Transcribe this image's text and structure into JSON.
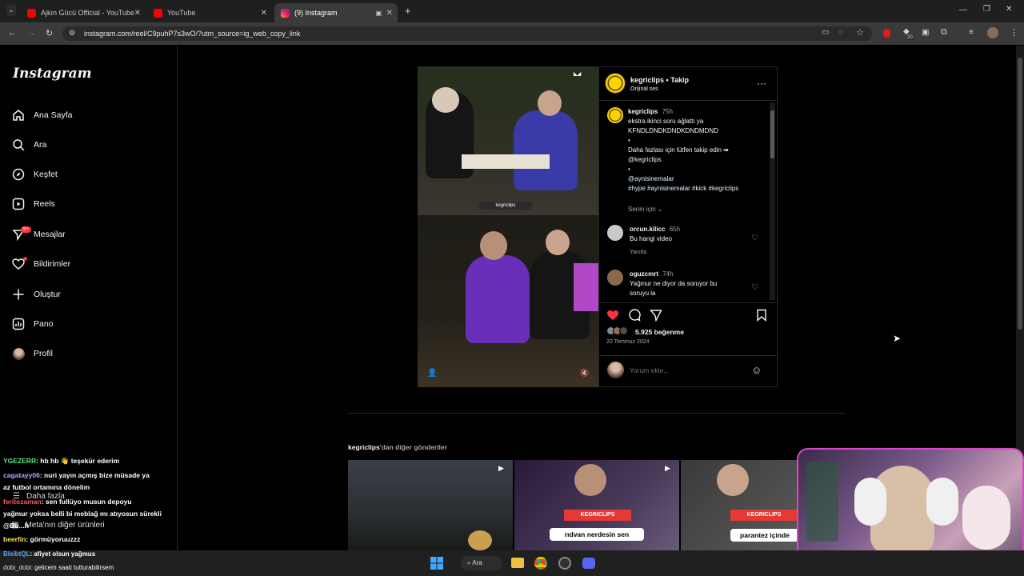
{
  "browser": {
    "tabs": [
      {
        "title": "Ajkın Gücü Official - YouTube"
      },
      {
        "title": "YouTube"
      },
      {
        "title": "(9) Instagram"
      }
    ],
    "url": "instagram.com/reel/C9puhP7s3wO/?utm_source=ig_web_copy_link",
    "new_tab": "+",
    "extension_badge": "20"
  },
  "sidebar": {
    "logo": "Instagram",
    "items": [
      {
        "label": "Ana Sayfa",
        "icon": "home-icon"
      },
      {
        "label": "Ara",
        "icon": "search-icon"
      },
      {
        "label": "Keşfet",
        "icon": "compass-icon"
      },
      {
        "label": "Reels",
        "icon": "reels-icon"
      },
      {
        "label": "Mesajlar",
        "icon": "messenger-icon",
        "badge": "9+"
      },
      {
        "label": "Bildirimler",
        "icon": "heart-icon"
      },
      {
        "label": "Oluştur",
        "icon": "plus-icon"
      },
      {
        "label": "Pano",
        "icon": "dashboard-icon"
      },
      {
        "label": "Profil",
        "icon": "avatar"
      }
    ],
    "more": "Daha fazla",
    "meta": "Meta'nın diğer ürünleri"
  },
  "post": {
    "username": "kegriclips",
    "follow": "Takip",
    "audio": "Orijinal ses",
    "caption": {
      "username": "kegriclips",
      "time": "75h",
      "lines": [
        "ekstra ikinci soru ağlattı ya",
        "KFNDLDNDKDNDKDNDMDND",
        "•",
        "Daha fazlası için lütfen takip edin ➡",
        "@kegriclips",
        "•",
        "@aynisinemalar",
        "#hype #aynisinemalar #kick #kegriclips"
      ]
    },
    "sort": "Senin için",
    "comments": [
      {
        "username": "orcun.kilicc",
        "time": "65h",
        "text": [
          "Bu hangi video"
        ],
        "reply": "Yanıtla"
      },
      {
        "username": "oguzcmrt",
        "time": "74h",
        "text": [
          "Yağmur ne diyor da soruyor bu",
          "soruyu la"
        ]
      }
    ],
    "likes": "5.925 beğenme",
    "date": "20 Temmuz 2024",
    "comment_placeholder": "Yorum ekle...",
    "video_watermark": "kegriclips"
  },
  "more_posts": {
    "title_user": "kegriclips",
    "title_suffix": "'dan diğer gönderiler",
    "thumbs": [
      {
        "caption": ""
      },
      {
        "caption": "rıdvan nerdesin sen",
        "brand": "KEGRICLIPS"
      },
      {
        "caption": "parantez içinde",
        "brand": "KEGRICLIPS"
      }
    ]
  },
  "chat": [
    {
      "user": "YGEZERR",
      "msg": ": hb hb 👋 teşekür ederim",
      "color": "#59e08a"
    },
    {
      "user": "cagatayy06",
      "msg": ": nuri yayın açmış bize müsade ya",
      "color": "#b8a5ff"
    },
    {
      "user": "",
      "msg": "az futbol ortamına dönelim",
      "color": "#ffffff"
    },
    {
      "user": "feritozaman",
      "msg": ": sen fullüyo musun depoyu",
      "color": "#ff5a5a"
    },
    {
      "user": "",
      "msg": "yağmur yoksa belli bi meblağ mı atıyosun sürekli",
      "color": "#ffffff"
    },
    {
      "user": "@Bu...h",
      "msg": "",
      "color": "#ffffff"
    },
    {
      "user": "beerfin",
      "msg": ": görmüyoruuzzz",
      "color": "#ffe25a"
    },
    {
      "user": "BleibtQL",
      "msg": ": afiyet olsun yağmus",
      "color": "#5aa0ff"
    },
    {
      "user": "dobi_dobi",
      "msg": ": gelicem saati tutturabilirsem",
      "color": "#dddddd"
    }
  ],
  "taskbar": {
    "search": "Ara"
  }
}
